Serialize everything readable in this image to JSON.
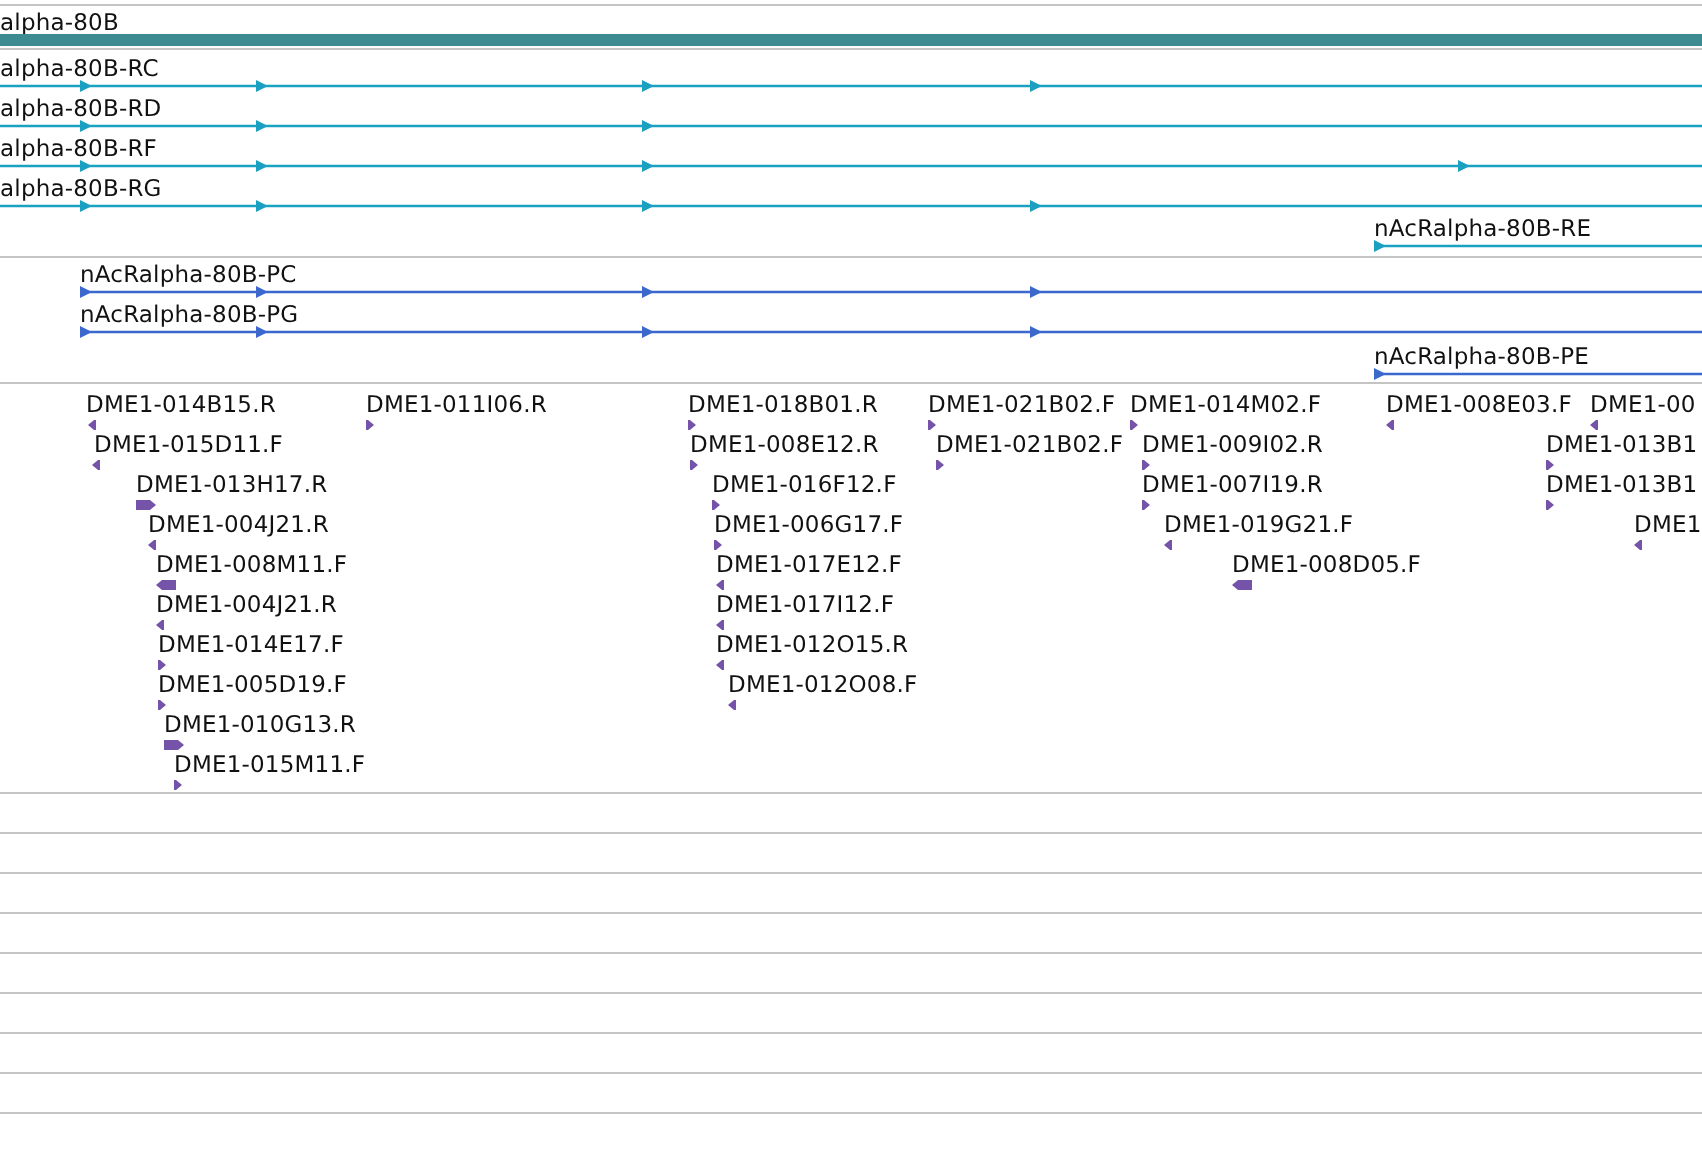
{
  "gene": {
    "label": "alpha-80B"
  },
  "transcripts": [
    {
      "label": "alpha-80B-RC"
    },
    {
      "label": "alpha-80B-RD"
    },
    {
      "label": "alpha-80B-RF"
    },
    {
      "label": "alpha-80B-RG"
    },
    {
      "label": "nAcRalpha-80B-RE"
    }
  ],
  "proteins": [
    {
      "label": "nAcRalpha-80B-PC"
    },
    {
      "label": "nAcRalpha-80B-PG"
    },
    {
      "label": "nAcRalpha-80B-PE"
    }
  ],
  "ests": [
    {
      "label": "DME1-014B15.R",
      "kind": "reverse"
    },
    {
      "label": "DME1-015D11.F",
      "kind": "reverse"
    },
    {
      "label": "DME1-013H17.R",
      "kind": "forward"
    },
    {
      "label": "DME1-004J21.R",
      "kind": "reverse"
    },
    {
      "label": "DME1-008M11.F",
      "kind": "reverse"
    },
    {
      "label": "DME1-004J21.R",
      "kind": "reverse"
    },
    {
      "label": "DME1-014E17.F",
      "kind": "forward"
    },
    {
      "label": "DME1-005D19.F",
      "kind": "forward"
    },
    {
      "label": "DME1-010G13.R",
      "kind": "forward"
    },
    {
      "label": "DME1-015M11.F",
      "kind": "forward"
    },
    {
      "label": "DME1-011I06.R",
      "kind": "forward"
    },
    {
      "label": "DME1-018B01.R",
      "kind": "forward"
    },
    {
      "label": "DME1-008E12.R",
      "kind": "forward"
    },
    {
      "label": "DME1-016F12.F",
      "kind": "forward"
    },
    {
      "label": "DME1-006G17.F",
      "kind": "forward"
    },
    {
      "label": "DME1-017E12.F",
      "kind": "reverse"
    },
    {
      "label": "DME1-017I12.F",
      "kind": "reverse"
    },
    {
      "label": "DME1-012O15.R",
      "kind": "reverse"
    },
    {
      "label": "DME1-012O08.F",
      "kind": "reverse"
    },
    {
      "label": "DME1-021B02.F",
      "kind": "forward"
    },
    {
      "label": "DME1-021B02.F",
      "kind": "forward"
    },
    {
      "label": "DME1-014M02.F",
      "kind": "forward"
    },
    {
      "label": "DME1-009I02.R",
      "kind": "forward"
    },
    {
      "label": "DME1-007I19.R",
      "kind": "forward"
    },
    {
      "label": "DME1-019G21.F",
      "kind": "reverse"
    },
    {
      "label": "DME1-008D05.F",
      "kind": "reverse"
    },
    {
      "label": "DME1-008E03.F",
      "kind": "reverse"
    },
    {
      "label": "DME1-00",
      "kind": "reverse"
    },
    {
      "label": "DME1-013B1",
      "kind": "forward"
    },
    {
      "label": "DME1-013B1",
      "kind": "forward"
    },
    {
      "label": "DME1",
      "kind": "reverse"
    }
  ]
}
